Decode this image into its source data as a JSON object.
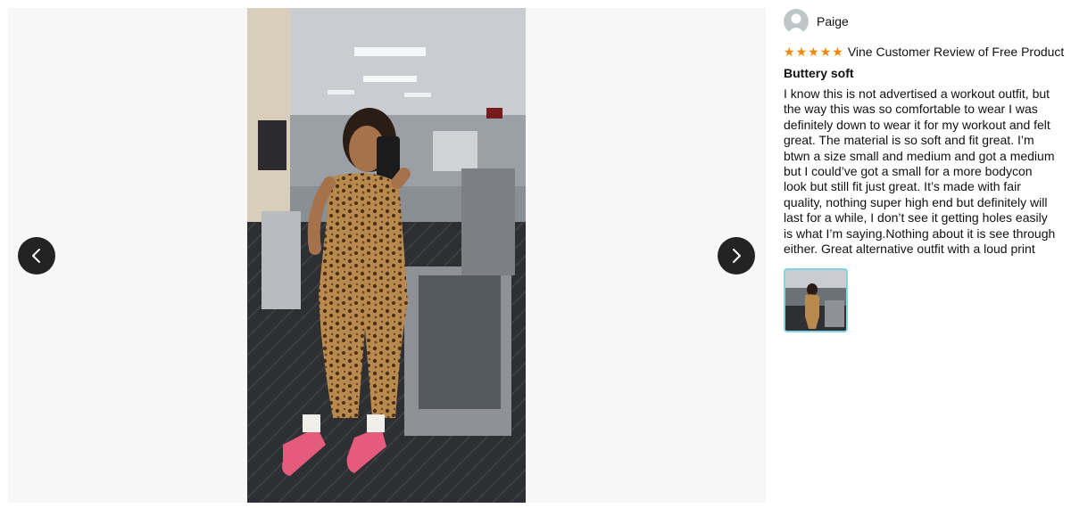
{
  "viewer": {
    "prev_icon": "chevron-left-icon",
    "next_icon": "chevron-right-icon"
  },
  "review": {
    "reviewer_name": "Paige",
    "rating": 5,
    "rating_max": 5,
    "badge_text": "Vine Customer Review of Free Product",
    "title": "Buttery soft",
    "body": "I know this is not advertised a workout outfit, but the way this was so comfortable to wear I was definitely down to wear it for my workout and felt great. The material is so soft and fit great. I’m btwn a size small and medium and got a medium but I could’ve got a small for a more bodycon look but still fit just great. It’s made with fair quality, nothing super high end but definitely will last for a while, I don’t see it getting holes easily is what I’m saying.Nothing about it is see through either. Great alternative outfit with a loud print"
  },
  "colors": {
    "star": "#f08804",
    "thumb_border": "#7fd5e6",
    "nav_button": "#232323"
  }
}
